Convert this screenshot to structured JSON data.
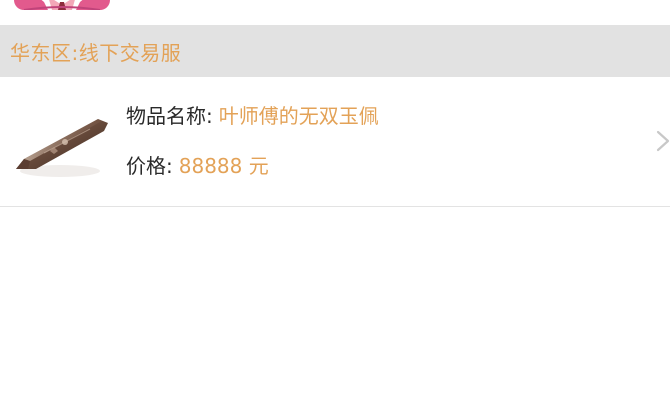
{
  "section": {
    "title": "华东区:线下交易服"
  },
  "item": {
    "name_label": "物品名称:",
    "name_value": "叶师傅的无双玉佩",
    "price_label": "价格:",
    "price_value": "88888 元"
  },
  "icons": {
    "item_image": "jade-pendant-icon",
    "chevron": "chevron-right-icon",
    "avatar": "avatar"
  },
  "colors": {
    "accent": "#e3a257",
    "section_bg": "#e2e2e2",
    "text": "#2a2a2a",
    "divider": "#e3e3e3",
    "avatar_pink": "#e25a8d"
  }
}
